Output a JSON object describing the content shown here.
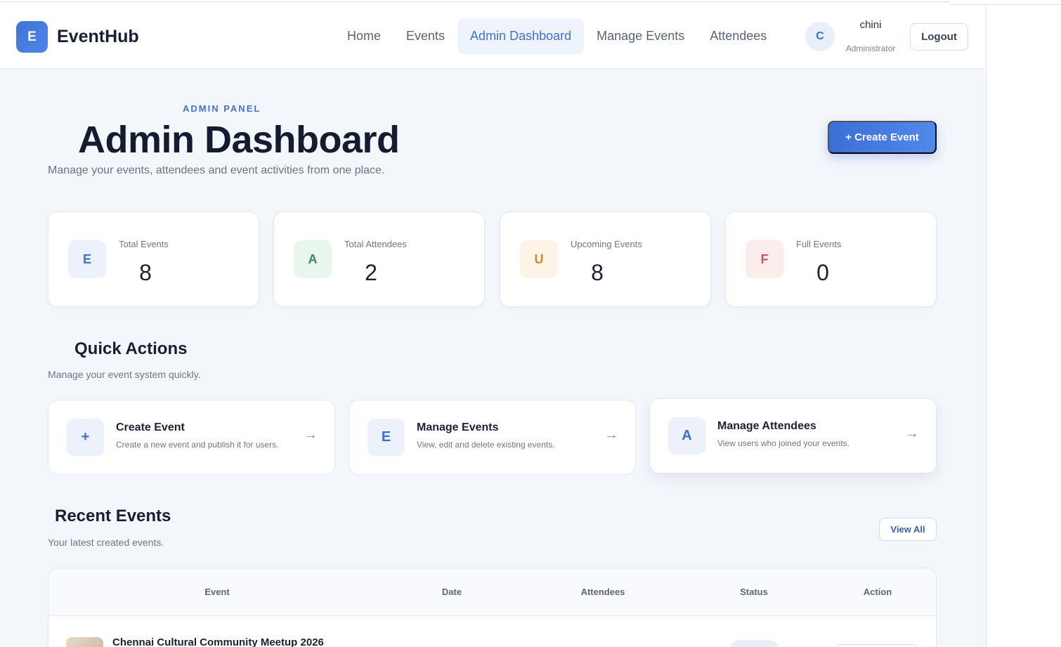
{
  "brand": {
    "logo_letter": "E",
    "name": "EventHub"
  },
  "nav": {
    "items": [
      {
        "label": "Home",
        "active": false
      },
      {
        "label": "Events",
        "active": false
      },
      {
        "label": "Admin Dashboard",
        "active": true
      },
      {
        "label": "Manage Events",
        "active": false
      },
      {
        "label": "Attendees",
        "active": false
      }
    ]
  },
  "user": {
    "initial": "C",
    "name": "chini",
    "role": "Administrator",
    "logout_label": "Logout"
  },
  "hero": {
    "kicker": "ADMIN PANEL",
    "title": "Admin Dashboard",
    "subtitle": "Manage your events, attendees and event activities from one place.",
    "create_label": "+ Create Event"
  },
  "stats": [
    {
      "letter": "E",
      "label": "Total Events",
      "value": "8",
      "color": "#3f6fcc",
      "bg": "#ecf1fb"
    },
    {
      "letter": "A",
      "label": "Total Attendees",
      "value": "2",
      "color": "#3c8a5f",
      "bg": "#e9f6ee"
    },
    {
      "letter": "U",
      "label": "Upcoming Events",
      "value": "8",
      "color": "#c98a2f",
      "bg": "#fdf4e7"
    },
    {
      "letter": "F",
      "label": "Full Events",
      "value": "0",
      "color": "#c8575d",
      "bg": "#fcecec"
    }
  ],
  "quick_actions": {
    "title": "Quick Actions",
    "subtitle": "Manage your event system quickly.",
    "items": [
      {
        "icon": "+",
        "title": "Create Event",
        "desc": "Create a new event and publish it for users.",
        "arrow": "→"
      },
      {
        "icon": "E",
        "title": "Manage Events",
        "desc": "View, edit and delete existing events.",
        "arrow": "→"
      },
      {
        "icon": "A",
        "title": "Manage Attendees",
        "desc": "View users who joined your events.",
        "arrow": "→"
      }
    ]
  },
  "recent_events": {
    "title": "Recent Events",
    "subtitle": "Your latest created events.",
    "view_all_label": "View All",
    "columns": [
      "Event",
      "Date",
      "Attendees",
      "Status",
      "Action"
    ],
    "rows": [
      {
        "event": "Chennai Cultural Community Meetup 2026"
      }
    ]
  }
}
